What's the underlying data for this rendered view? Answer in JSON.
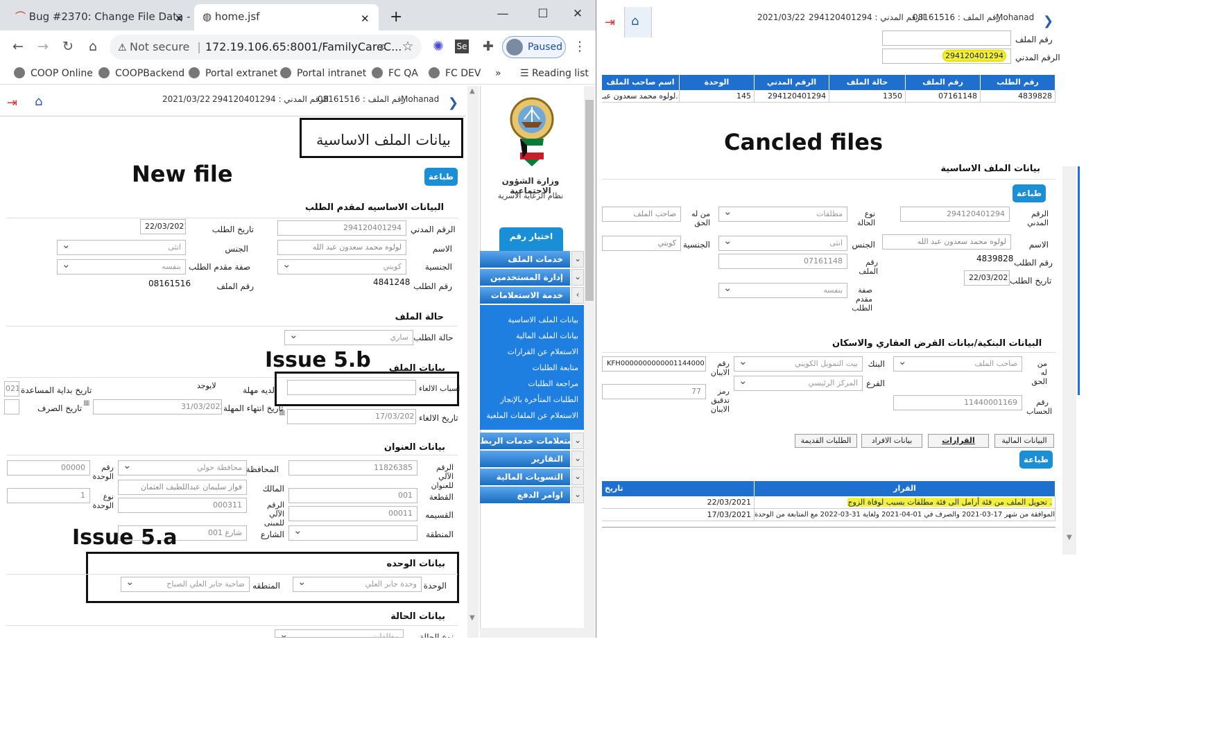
{
  "browser": {
    "tabs": [
      {
        "title": "Bug #2370: Change File Data - su"
      },
      {
        "title": "home.jsf"
      }
    ],
    "not_secure": "Not secure",
    "url": "172.19.106.65:8001/FamilyCareC...",
    "paused": "Paused",
    "bookmarks": [
      "COOP Online",
      "COOPBackend",
      "Portal extranet",
      "Portal intranet",
      "FC QA",
      "FC DEV"
    ],
    "bookmarks_more": "»",
    "reading_list": "Reading list"
  },
  "header": {
    "user": "Mohanad",
    "file_no": "رقم الملف : 08161516",
    "civil_id": "الرقم المدني : 294120401294",
    "date": "2021/03/22"
  },
  "annotations": {
    "new_file": "New file",
    "issue_5b": "Issue 5.b",
    "issue_5a": "Issue 5.a",
    "canceled": "Cancled files"
  },
  "left": {
    "page_title": "بيانات الملف الاساسية",
    "print": "طباعة",
    "sec_applicant": "البيانات الاساسيه لمقدم الطلب",
    "civil_label": "الرقم المدني",
    "civil_val": "294120401294",
    "date_label": "تاريخ الطلب",
    "date_val": "22/03/2021",
    "name_label": "الاسم",
    "name_val": "لولوه محمد سعدون عبد الله",
    "gender_label": "الجنس",
    "gender_val": "انثى",
    "nat_label": "الجنسية",
    "nat_val": "كويتي",
    "role_label": "صفة مقدم الطلب",
    "role_val": "بنفسه",
    "req_label": "رقم الطلب",
    "req_val": "4841248",
    "file_label": "رقم الملف",
    "file_val": "08161516",
    "sec_status": "حالة الملف",
    "status_label": "حالة الطلب",
    "status_val": "ساري",
    "sec_file": "بيانات الملف",
    "cancel_reason": "اسباب الالغاء",
    "has_grace": "لديه مهلة",
    "grace_val": "لايوجد",
    "aid_start": "تاريخ بداية المساعدة",
    "aid_start_val": "021",
    "cancel_date": "تاريخ الالغاء",
    "cancel_date_val": "17/03/2021",
    "grace_end": "تاريخ انتهاء المهلة",
    "grace_end_val": "31/03/2022",
    "pay_date": "تاريخ الصرف",
    "sec_address": "بيانات العنوان",
    "addr_id": "الرقم الآلي للعنوان",
    "addr_id_val": "11826385",
    "gov": "المحافظة",
    "gov_val": "محافظة حولي",
    "unit_no": "رقم الوحدة",
    "unit_no_val": "00000",
    "owner": "المالك",
    "owner_val": "فواز سليمان عبداللطيف العثمان",
    "plot": "القطعة",
    "plot_val": "001",
    "bldg": "الرقم الآلي للمبنى",
    "bldg_val": "000311",
    "unit_type": "نوع الوحدة",
    "unit_type_val": "1",
    "parcel": "القسيمه",
    "parcel_val": "00011",
    "street": "الشارع",
    "street_val": "شارع 001",
    "area": "المنطقة",
    "sec_unit": "بيانات الوحده",
    "unit": "الوحدة",
    "unit_val": "وحدة جابر العلي",
    "region": "المنطقه",
    "region_val": "ضاحية جابر العلي الصباح",
    "sec_case": "بيانات الحالة",
    "case_type": "نوع الحالة",
    "case_val": "مطلقات"
  },
  "sidebar": {
    "ministry": "وزارة الشؤون الاجتماعية",
    "system": "نظام الرعاية الاسرية",
    "choose_file": "اختيار رقم الملف",
    "menus": [
      "خدمات الملف",
      "إدارة المستخدمين",
      "خدمة الاستعلامات"
    ],
    "subitems": [
      "بيانات الملف الاساسية",
      "بيانات الملف المالية",
      "الاستعلام عن القرارات",
      "متابعة الطلبات",
      "مراجعة الطلبات",
      "الطلبات المتأخرة بالإنجاز",
      "الاستعلام عن الملفات الملغية"
    ],
    "menus2": [
      "استعلامات خدمات الربط",
      "التقارير",
      "التسويات المالية",
      "اوامر الدفع"
    ]
  },
  "right": {
    "file_no_label": "رقم الملف",
    "civil_label": "الرقم المدني",
    "civil_val": "294120401294",
    "table": {
      "headers": [
        "رقم الطلب",
        "رقم الملف",
        "حالة الملف",
        "الرقم المدني",
        "الوحدة",
        "اسم صاحب الملف"
      ],
      "row": [
        "4839828",
        "07161148",
        "1350",
        "294120401294",
        "145",
        "لولوه محمد سعدون عبـ..."
      ]
    },
    "page_title": "بيانات الملف الاساسية",
    "print": "طباعة",
    "civil2": "الرقم المدني",
    "civil2_val": "294120401294",
    "case_type": "نوع الحالة",
    "case_val": "مطلقات",
    "claimant": "من له الحق",
    "claimant_val": "صاحب الملف",
    "name": "الاسم",
    "name_val": "لولوه محمد سعدون عبد الله",
    "gender": "الجنس",
    "gender_val": "انثى",
    "nat": "الجنسية",
    "nat_val": "كويتي",
    "req": "رقم الطلب",
    "req_val": "4839828",
    "file": "رقم الملف",
    "file_val": "07161148",
    "date": "تاريخ الطلب",
    "date_val": "22/03/2021",
    "role": "صفة مقدم الطلب",
    "role_val": "بنفسه",
    "sec_bank": "البيانات البنكية/بيانات القرض العقاري والاسكان",
    "claimant2": "من له الحق",
    "claimant2_val": "صاحب الملف",
    "bank": "البنك",
    "bank_val": "بيت التمويل الكويتي",
    "iban": "رقم الايبان",
    "iban_val": "KFH00000000000011440001169",
    "branch": "الفرع",
    "branch_val": "المركز الرئيسي",
    "iban_check": "رمز تدقيق الايبان",
    "iban_check_val": "77",
    "account": "رقم الحساب",
    "account_val": "11440001169",
    "tabs": [
      "البيانات المالية",
      "القرارات",
      "بيانات الافراد",
      "الطلبات القديمة"
    ],
    "print2": "طباعة",
    "dec_headers": [
      "القرار",
      "تاريخ"
    ],
    "decisions": [
      {
        "text": "تحويل الملف من فئة أرامل الى فئة مطلقات بسبب لوفاة الزوج .",
        "date": "22/03/2021"
      },
      {
        "text": "الموافقة من شهر 17-03-2021 والصرف في 01-04-2021 ولغاية 31-03-2022 مع المتابعة من الوحدة.",
        "date": "17/03/2021"
      }
    ]
  },
  "colors": {
    "accent": "#1a8fd6",
    "menu": "#1b6dc0",
    "highlight": "#f1f13d"
  }
}
